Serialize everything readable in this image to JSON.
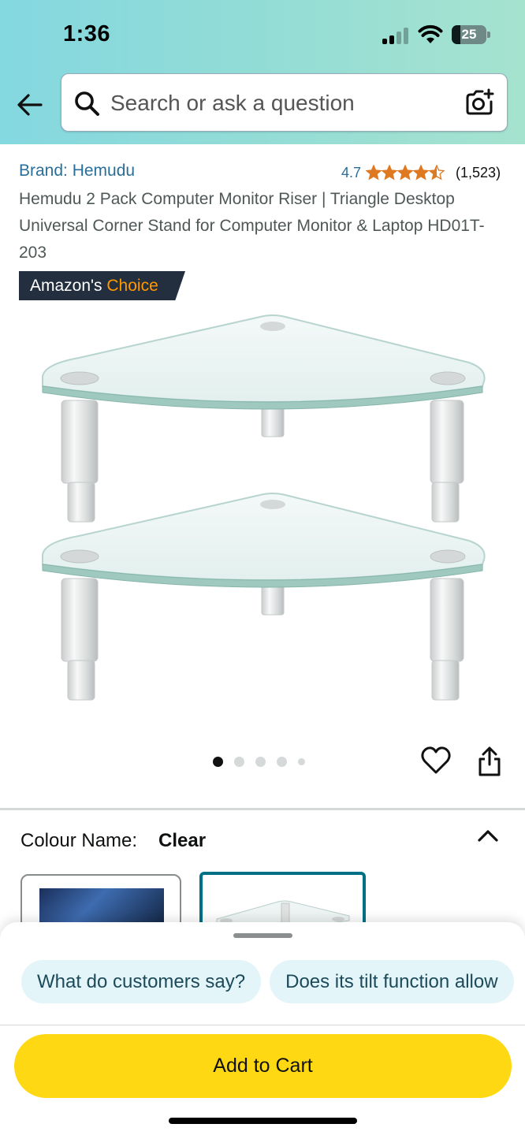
{
  "status_bar": {
    "time": "1:36",
    "battery_level": "25",
    "battery_fraction": 0.25
  },
  "search": {
    "placeholder": "Search or ask a question"
  },
  "product": {
    "brand": "Brand: Hemudu",
    "rating_value": "4.7",
    "rating_stars": 4.5,
    "rating_count": "(1,523)",
    "title": "Hemudu 2 Pack Computer Monitor Riser | Triangle Desktop Universal Corner Stand for Computer Monitor & Laptop HD01T-203",
    "badge_prefix": "Amazon's",
    "badge_accent": "Choice"
  },
  "image_carousel": {
    "total": 5,
    "active": 1
  },
  "colour": {
    "label": "Colour Name:",
    "value": "Clear"
  },
  "questions": {
    "chips": [
      "What do customers say?",
      "Does its tilt function allow"
    ]
  },
  "cart": {
    "add_label": "Add to Cart"
  },
  "colors": {
    "accent_link": "#2a6e9a",
    "cart_button": "#ffd814",
    "badge_bg": "#232f3e",
    "badge_accent": "#ff9900",
    "star": "#de7921"
  }
}
